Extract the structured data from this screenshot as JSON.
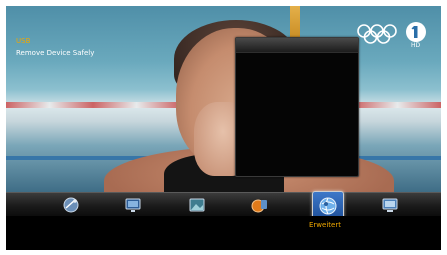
{
  "video": {
    "description_colors": {
      "pool": "#6aa9bd",
      "lane_red": "#cc4444",
      "pole": "#d9a13a"
    }
  },
  "overlay": {
    "olympic_rings_icon": "olympic-rings-icon",
    "channel_logo_icon": "channel-one-logo-icon",
    "channel_logo_sub": "HD"
  },
  "popup": {
    "title": "USB",
    "items": [
      {
        "label": "Remove Device Safely"
      }
    ],
    "title_color": "#f0a800"
  },
  "menu": {
    "items": [
      {
        "icon": "satellite-icon",
        "label": ""
      },
      {
        "icon": "tv-settings-icon",
        "label": ""
      },
      {
        "icon": "picture-icon",
        "label": ""
      },
      {
        "icon": "media-icon",
        "label": ""
      },
      {
        "icon": "globe-advanced-icon",
        "label": "Erweitert",
        "selected": true
      },
      {
        "icon": "system-monitor-icon",
        "label": ""
      }
    ],
    "selected_label": "Erweitert",
    "accent_color": "#f0a800"
  }
}
